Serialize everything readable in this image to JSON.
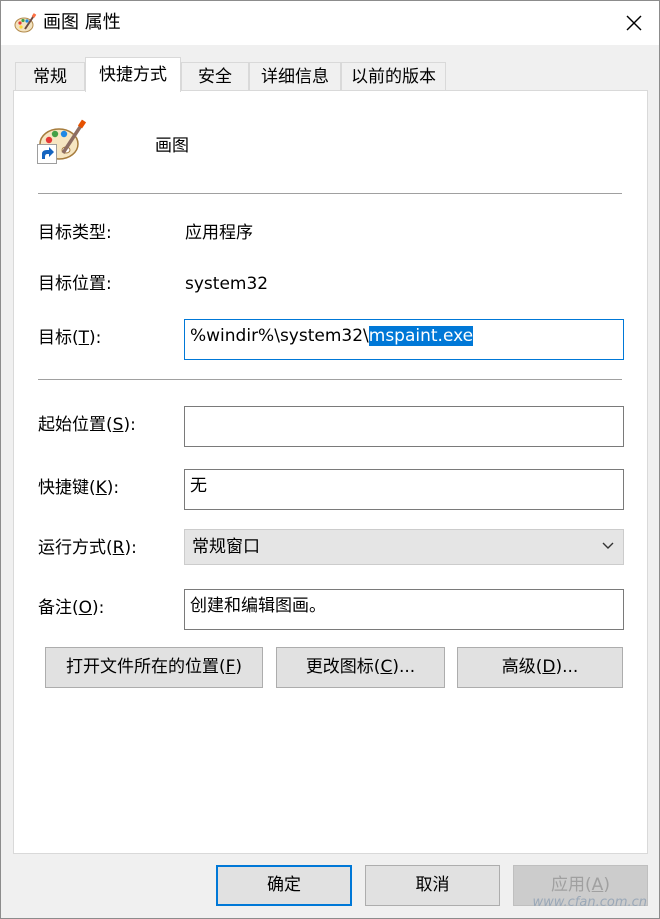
{
  "window": {
    "title": "画图 属性",
    "icon": "paint-palette-icon"
  },
  "tabs": [
    {
      "label": "常规",
      "active": false
    },
    {
      "label": "快捷方式",
      "active": true
    },
    {
      "label": "安全",
      "active": false
    },
    {
      "label": "详细信息",
      "active": false
    },
    {
      "label": "以前的版本",
      "active": false
    }
  ],
  "shortcut": {
    "name": "画图",
    "target_type_label": "目标类型:",
    "target_type_value": "应用程序",
    "target_location_label": "目标位置:",
    "target_location_value": "system32",
    "target_label_prefix": "目标(",
    "target_label_key": "T",
    "target_label_suffix": "):",
    "target_value_unselected": "%windir%\\system32\\",
    "target_value_selected": "mspaint.exe",
    "start_in_label_prefix": "起始位置(",
    "start_in_label_key": "S",
    "start_in_label_suffix": "):",
    "start_in_value": "",
    "hotkey_label_prefix": "快捷键(",
    "hotkey_label_key": "K",
    "hotkey_label_suffix": "):",
    "hotkey_value": "无",
    "run_label_prefix": "运行方式(",
    "run_label_key": "R",
    "run_label_suffix": "):",
    "run_value": "常规窗口",
    "comment_label_prefix": "备注(",
    "comment_label_key": "O",
    "comment_label_suffix": "):",
    "comment_value": "创建和编辑图画。"
  },
  "action_buttons": {
    "open_location_prefix": "打开文件所在的位置(",
    "open_location_key": "F",
    "open_location_suffix": ")",
    "change_icon_prefix": "更改图标(",
    "change_icon_key": "C",
    "change_icon_suffix": ")...",
    "advanced_prefix": "高级(",
    "advanced_key": "D",
    "advanced_suffix": ")..."
  },
  "footer": {
    "ok_label": "确定",
    "cancel_label": "取消",
    "apply_prefix": "应用(",
    "apply_key": "A",
    "apply_suffix": ")"
  },
  "watermark": "www.cfan.com.cn",
  "colors": {
    "accent": "#0078d7",
    "window_bg": "#f0f0f0",
    "panel_bg": "#ffffff"
  }
}
